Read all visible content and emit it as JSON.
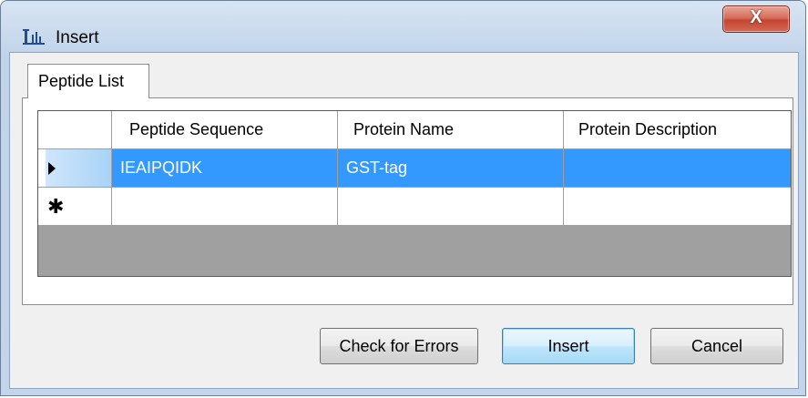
{
  "window": {
    "title": "Insert",
    "close_label": "X"
  },
  "tabs": [
    {
      "label": "Peptide List",
      "selected": true
    }
  ],
  "grid": {
    "columns": [
      "Peptide Sequence",
      "Protein Name",
      "Protein Description"
    ],
    "rows": [
      {
        "indicator": "current-row-arrow",
        "selected": true,
        "cells": [
          "IEAIPQIDK",
          "GST-tag",
          ""
        ]
      },
      {
        "indicator": "new-row-asterisk",
        "selected": false,
        "cells": [
          "",
          "",
          ""
        ]
      }
    ],
    "selection_color": "#3399ff"
  },
  "buttons": {
    "check_errors": "Check for Errors",
    "insert": "Insert",
    "cancel": "Cancel"
  },
  "colors": {
    "close_button": "#c44530",
    "grid_background": "#a0a0a0"
  }
}
